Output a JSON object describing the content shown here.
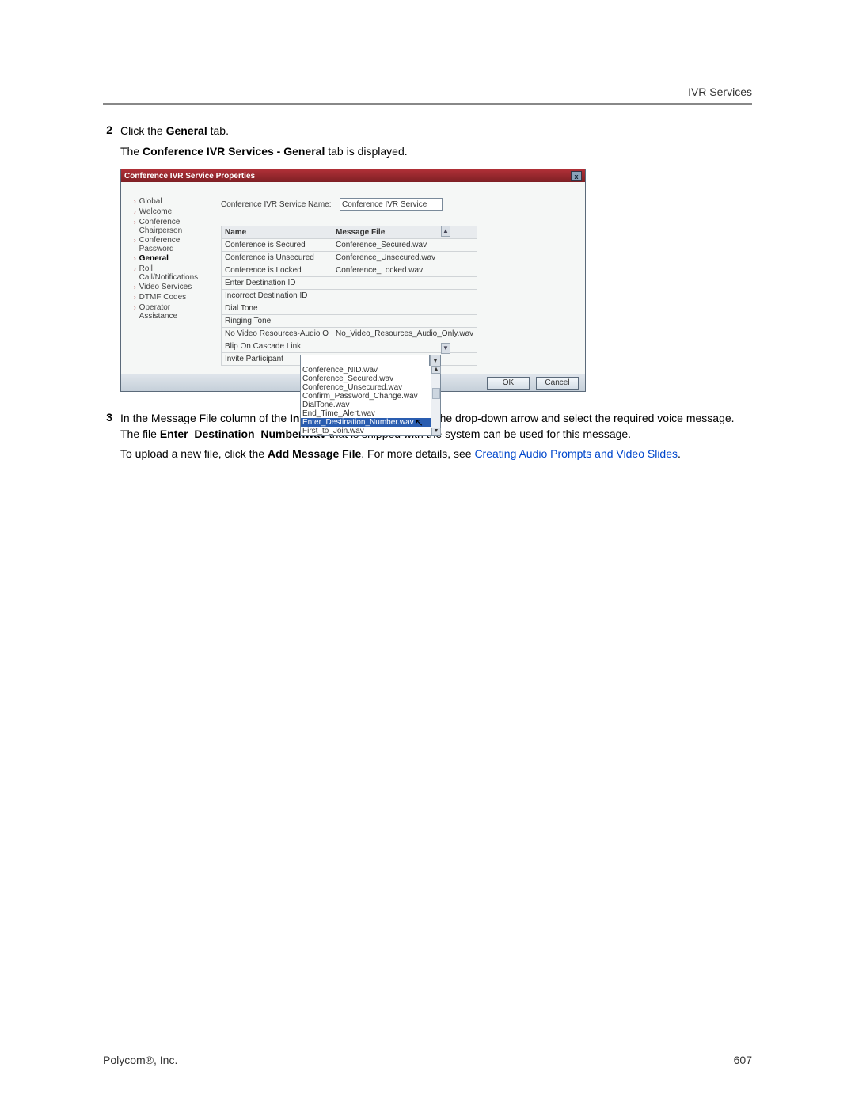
{
  "header": {
    "section": "IVR Services"
  },
  "steps": {
    "s2_num": "2",
    "s2_a": "Click the ",
    "s2_bold": "General",
    "s2_b": " tab.",
    "s2_line2_a": "The ",
    "s2_line2_bold": "Conference IVR Services - General",
    "s2_line2_b": " tab is displayed.",
    "s3_num": "3",
    "s3_a": "In the Message File column of the ",
    "s3_bold1": "Invite Participant",
    "s3_b": " entry, click the drop-down arrow and select the required voice message. The file ",
    "s3_bold2": "Enter_Destination_Number.wav",
    "s3_c": " that is shipped with the system can be used for this message.",
    "s3_p2_a": "To upload a new file, click the ",
    "s3_p2_bold": "Add Message File",
    "s3_p2_b": ". For more details, see ",
    "s3_p2_link": "Creating Audio Prompts and Video Slides",
    "s3_p2_c": "."
  },
  "dialog": {
    "title": "Conference IVR Service Properties",
    "close": "x",
    "sidebar": [
      "Global",
      "Welcome",
      "Conference Chairperson",
      "Conference Password",
      "General",
      "Roll Call/Notifications",
      "Video Services",
      "DTMF Codes",
      "Operator Assistance"
    ],
    "selected_sidebar_index": 4,
    "field_label": "Conference IVR Service Name:",
    "field_value": "Conference IVR Service",
    "col1": "Name",
    "col2": "Message File",
    "rows": [
      {
        "name": "Conference is Secured",
        "file": "Conference_Secured.wav"
      },
      {
        "name": "Conference is Unsecured",
        "file": "Conference_Unsecured.wav"
      },
      {
        "name": "Conference is Locked",
        "file": "Conference_Locked.wav"
      },
      {
        "name": "Enter Destination ID",
        "file": ""
      },
      {
        "name": "Incorrect Destination ID",
        "file": ""
      },
      {
        "name": "Dial Tone",
        "file": ""
      },
      {
        "name": "Ringing Tone",
        "file": ""
      },
      {
        "name": "No Video Resources-Audio O",
        "file": "No_Video_Resources_Audio_Only.wav"
      },
      {
        "name": "Blip On Cascade Link",
        "file": ""
      },
      {
        "name": "Invite Participant",
        "file": ""
      }
    ],
    "dropdown": {
      "options": [
        "Conference_NID.wav",
        "Conference_Secured.wav",
        "Conference_Unsecured.wav",
        "Confirm_Password_Change.wav",
        "DialTone.wav",
        "End_Time_Alert.wav",
        "Enter_Destination_Number.wav",
        "First_to_Join.wav"
      ],
      "selected_index": 6
    },
    "ok": "OK",
    "cancel": "Cancel"
  },
  "footer": {
    "left": "Polycom®, Inc.",
    "right": "607"
  },
  "glyphs": {
    "up": "▲",
    "down": "▼",
    "cursor": "↖"
  }
}
